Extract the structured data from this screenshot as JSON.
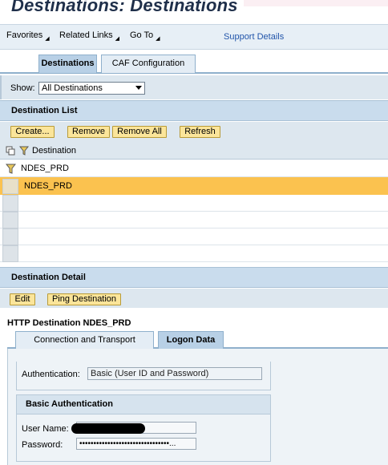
{
  "title": "Destinations: Destinations",
  "menu": {
    "favorites": "Favorites",
    "related_links": "Related Links",
    "go_to": "Go To",
    "support_details": "Support Details"
  },
  "tabs": [
    "Destinations",
    "CAF Configuration"
  ],
  "show": {
    "label": "Show:",
    "selected": "All Destinations"
  },
  "destination_list": {
    "header": "Destination List",
    "buttons": {
      "create": "Create...",
      "remove": "Remove",
      "remove_all": "Remove All",
      "refresh": "Refresh"
    },
    "column": "Destination",
    "filter_value": "NDES_PRD",
    "rows": [
      "NDES_PRD"
    ]
  },
  "destination_detail": {
    "header": "Destination Detail",
    "buttons": {
      "edit": "Edit",
      "ping": "Ping Destination"
    },
    "title": "HTTP Destination NDES_PRD",
    "tabs": [
      "Connection and Transport",
      "Logon Data"
    ],
    "authentication_label": "Authentication:",
    "authentication_value": "Basic (User ID and Password)",
    "basic_auth_header": "Basic Authentication",
    "user_name_label": "User Name:",
    "password_label": "Password:",
    "password_value": "••••••••••••••••••••••••••••••••..."
  },
  "colors": {
    "selected_row": "#fbc24f",
    "button_bg": "#fbe59a",
    "section_header": "#c9dced",
    "link": "#2255aa"
  }
}
